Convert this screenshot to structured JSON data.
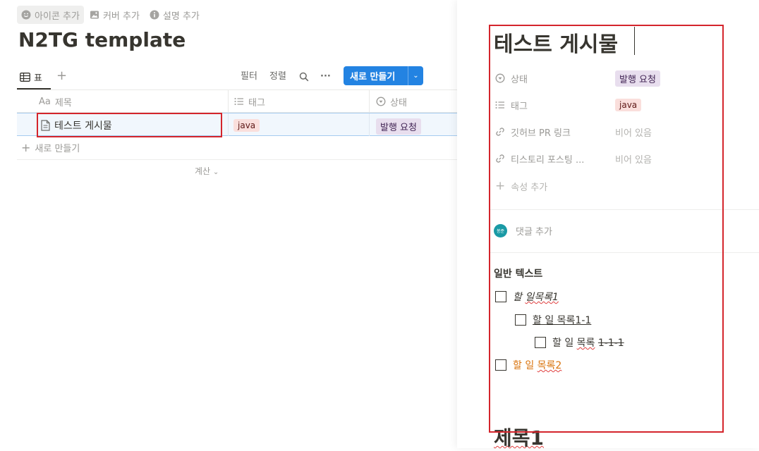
{
  "left": {
    "top_actions": {
      "add_icon": "아이콘 추가",
      "add_cover": "커버 추가",
      "add_description": "설명 추가"
    },
    "title": "N2TG template",
    "view_tab": {
      "label": "표"
    },
    "toolbar": {
      "filter": "필터",
      "sort": "정렬",
      "more": "···",
      "new_button": "새로 만들기"
    },
    "columns": [
      {
        "prefix": "Aa",
        "label": "제목"
      },
      {
        "label": "태그"
      },
      {
        "label": "상태"
      }
    ],
    "rows": [
      {
        "title": "테스트 게시물",
        "tag": "java",
        "status": "발행 요청"
      }
    ],
    "add_row": "새로 만들기",
    "calculate": "계산"
  },
  "peek": {
    "title": "테스트 게시물",
    "properties": [
      {
        "icon": "status-icon",
        "name": "상태",
        "value": "발행 요청"
      },
      {
        "icon": "list-icon",
        "name": "태그",
        "value": "java"
      },
      {
        "icon": "link-icon",
        "name": "깃허브 PR 링크",
        "value": "비어 있음"
      },
      {
        "icon": "link-icon",
        "name": "티스토리 포스팅 ...",
        "value": "비어 있음"
      }
    ],
    "add_property": "속성 추가",
    "comment": {
      "avatar_text": "봉준",
      "placeholder": "댓글 추가"
    },
    "section_label": "일반 텍스트",
    "todos": [
      {
        "text_a": "할",
        "text_b": "일목록1"
      },
      {
        "text": "할 일 목록1-1"
      },
      {
        "text_a": "할 일",
        "text_b": "목록",
        "text_c": "1-1-1"
      },
      {
        "text_a": "할 일",
        "text_b": "목록2"
      }
    ],
    "heading": "제목1"
  },
  "colors": {
    "accent": "#2383e2",
    "highlight_box": "#d4252c",
    "status_bg": "#e8deee",
    "tag_bg": "#fadfdc",
    "orange_text": "#d9730d"
  }
}
